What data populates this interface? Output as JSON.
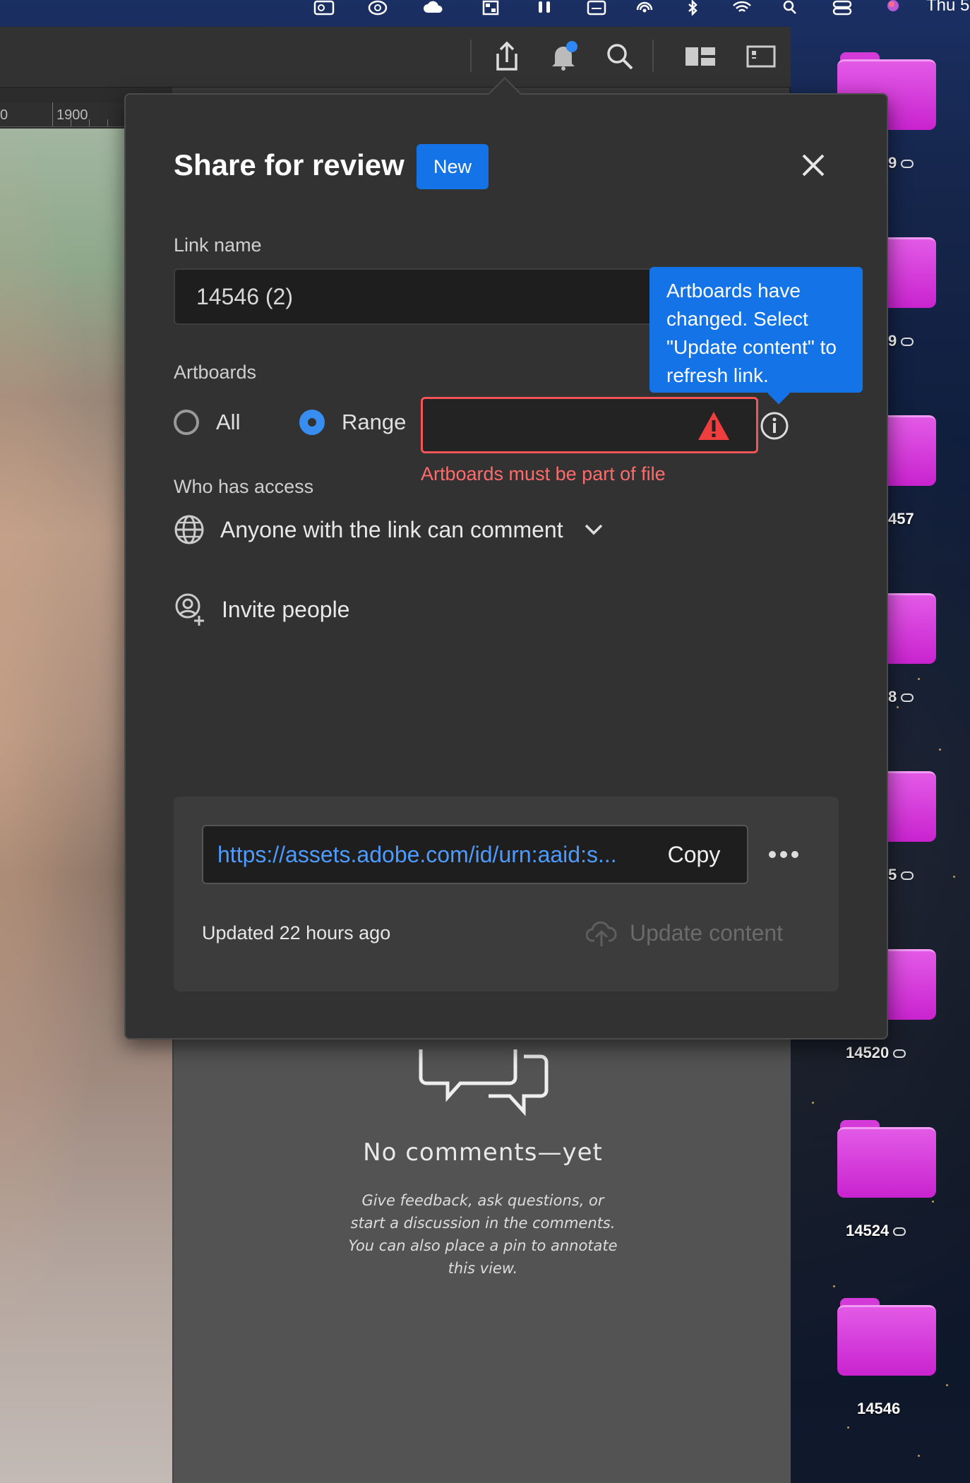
{
  "desktop": {
    "clock_text": "Thu 5",
    "folders": [
      {
        "label": "9"
      },
      {
        "label": "9"
      },
      {
        "label": "457"
      },
      {
        "label": "8"
      },
      {
        "label": "5"
      },
      {
        "label": "14520"
      },
      {
        "label": "14524"
      },
      {
        "label": "14546"
      }
    ],
    "folder_color": "#d43ad8"
  },
  "app": {
    "ruler_label": "1900",
    "ruler_label_left": "0",
    "toolbar_icons": [
      "share-icon",
      "notification-bell-icon",
      "search-icon",
      "grid-layout-icon",
      "panel-layout-icon"
    ],
    "comments": {
      "title": "No comments—yet",
      "description": "Give feedback, ask questions, or start a discussion in the comments. You can also place a pin to annotate this view."
    }
  },
  "dialog": {
    "title": "Share for review",
    "badge": "New",
    "link_name": {
      "label": "Link name",
      "value": "14546 (2)"
    },
    "tooltip": "Artboards have changed. Select \"Update content\" to refresh link.",
    "artboards": {
      "label": "Artboards",
      "options": [
        {
          "label": "All",
          "selected": false
        },
        {
          "label": "Range",
          "selected": true
        }
      ],
      "range_value": "",
      "error": "Artboards must be part of file"
    },
    "access": {
      "label": "Who has access",
      "value": "Anyone with the link can comment"
    },
    "invite": "Invite people",
    "link": {
      "url": "https://assets.adobe.com/id/urn:aaid:s...",
      "copy_label": "Copy",
      "updated": "Updated 22 hours ago",
      "update_content_label": "Update content"
    }
  },
  "colors": {
    "accent": "#1473e6",
    "error": "#f25555",
    "link": "#4d9bff",
    "dialog_bg": "#323232"
  }
}
